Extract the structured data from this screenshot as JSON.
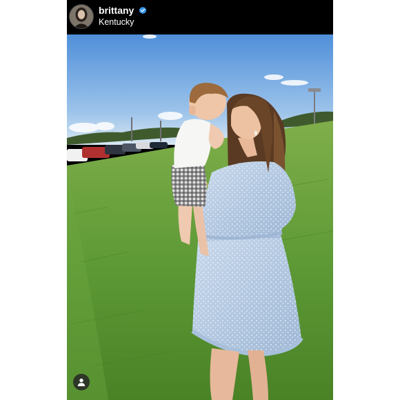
{
  "post": {
    "username": "brittany",
    "verified": true,
    "location": "Kentucky",
    "avatar_icon": "profile-avatar",
    "verified_icon": "verified-badge-icon",
    "tag_icon": "user-tag-icon"
  },
  "colors": {
    "header_bg": "#000000",
    "verified_blue": "#3897f0",
    "sky": "#7fb2e8",
    "grass": "#5f9a3a",
    "dress": "#b9cde4"
  }
}
